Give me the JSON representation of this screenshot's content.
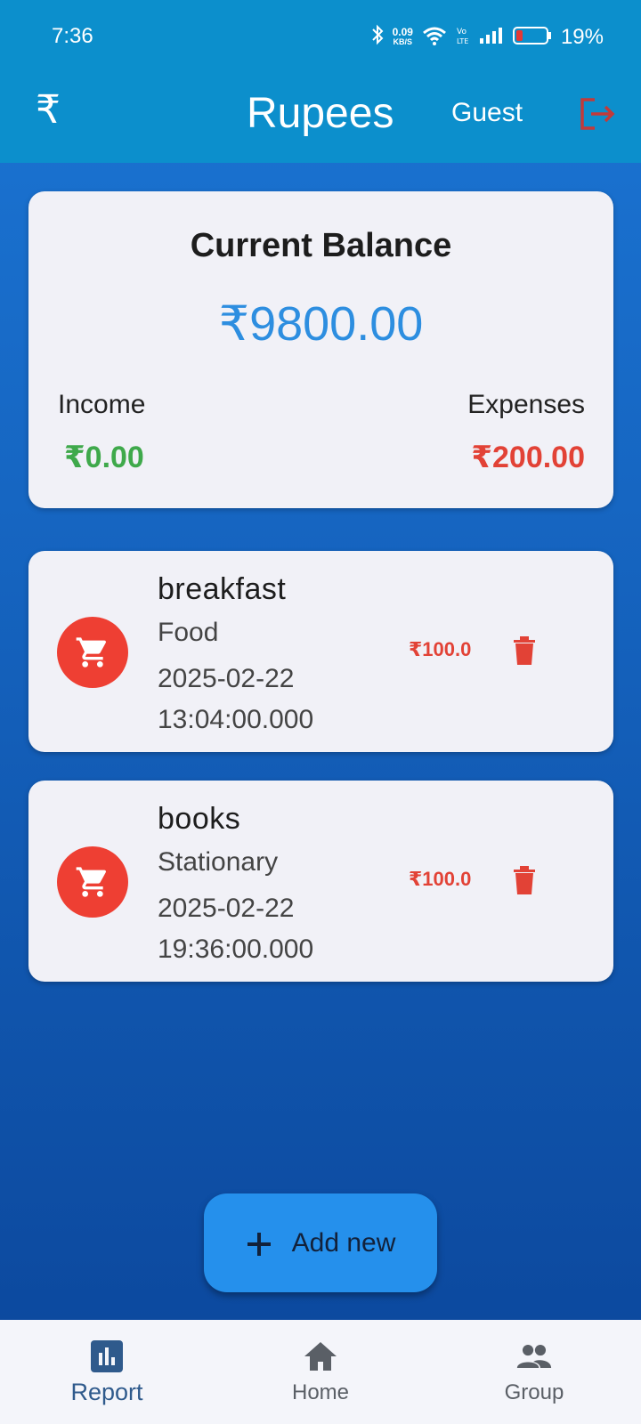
{
  "status_bar": {
    "time": "7:36",
    "net_speed_value": "0.09",
    "net_speed_unit": "KB/S",
    "battery_percent": "19%"
  },
  "app_bar": {
    "currency_icon": "rupee-icon",
    "title": "Rupees",
    "user": "Guest",
    "logout_icon": "logout-icon"
  },
  "balance": {
    "title": "Current Balance",
    "amount": "₹9800.00",
    "income_label": "Income",
    "income_value": "₹0.00",
    "expenses_label": "Expenses",
    "expenses_value": "₹200.00"
  },
  "transactions": [
    {
      "title": "breakfast",
      "category": "Food",
      "date": "2025-02-22 13:04:00.000",
      "amount": "₹100.0",
      "icon": "cart-icon"
    },
    {
      "title": "books",
      "category": "Stationary",
      "date": "2025-02-22 19:36:00.000",
      "amount": "₹100.0",
      "icon": "cart-icon"
    }
  ],
  "fab": {
    "label": "Add new",
    "icon": "plus-icon"
  },
  "nav": {
    "report": "Report",
    "home": "Home",
    "group": "Group"
  },
  "colors": {
    "app_bar": "#0c8fcc",
    "balance_amount": "#2d8ee0",
    "income": "#3fa94b",
    "expense": "#e24236",
    "fab": "#2590ec",
    "nav_active": "#2f5a8c"
  }
}
